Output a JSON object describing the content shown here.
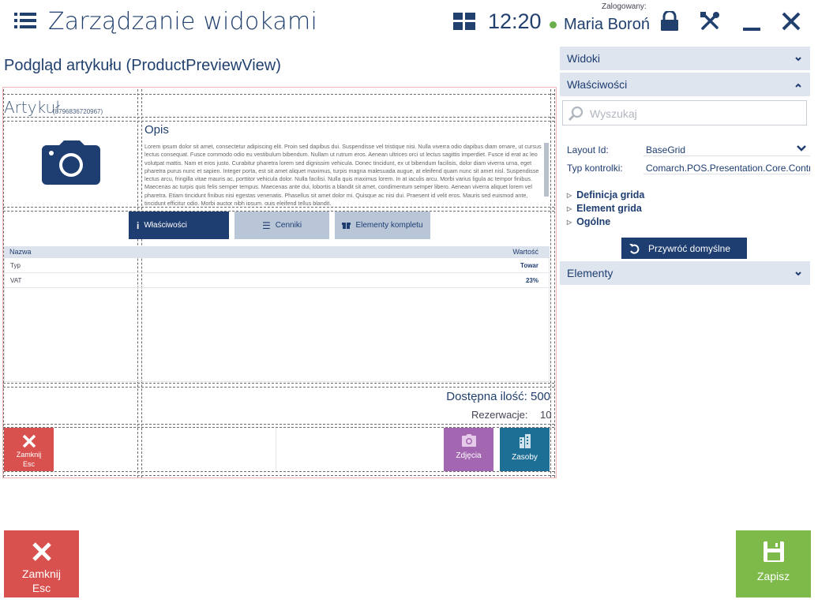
{
  "header": {
    "title": "Zarządzanie widokami",
    "time": "12:20",
    "logged_label": "Zalogowany:",
    "user": "Maria Boroń"
  },
  "preview": {
    "title": "Podgląd artykułu (ProductPreviewView)",
    "article_label": "Artykuł",
    "article_code": "(8796836720967)",
    "description_title": "Opis",
    "description_text": "Lorem ipsum dolor sit amet, consectetur adipiscing elit. Proin sed dapibus dui. Suspendisse vel tristique nisi. Nulla viverra odio dapibus diam ornare, ut cursus lectus consequat. Fusce commodo odio eu vestibulum bibendum. Nullam ut rutrum eros. Aenean ultrices orci ut lectus sagittis imperdiet. Fusce id erat ac leo volutpat mattis. Nam et eros justo. Curabitur pharetra lorem sed dignissim vehicula. Donec tincidunt, ex ut bibendum facilisis, dolor diam viverra urna, eget pharetra purus nunc et sapien. Integer porta, est sit amet aliquet maximus, turpis magna malesuada augue, at eleifend quam nunc sit amet nisl. Suspendisse lectus arcu, fringilla vitae mauris ac, porttitor vehicula dolor. Nulla facilisi. Nulla quis maximus lorem. In at iaculis arcu. Morbi varius ligula ac tempor finibus. Maecenas ac turpis quis felis semper tempus. Maecenas ante dui, lobortis a blandit sit amet, condimentum semper libero. Aenean viverra aliquet lorem vel pharetra. Etiam tincidunt finibus nisi egestas venenatis. Phasellus sit amet dolor mi. Quisque ac nisi dui. Praesent id velit eros. Mauris sed euismod ante, tincidunt efficitur odio. Morbi auctor nibh ipsum, quis eleifend tellus blandit.",
    "tabs": [
      {
        "label": "Właściwości"
      },
      {
        "label": "Cenniki"
      },
      {
        "label": "Elementy kompletu"
      }
    ],
    "table": {
      "col_name": "Nazwa",
      "col_value": "Wartość",
      "rows": [
        {
          "name": "Typ",
          "value": "Towar"
        },
        {
          "name": "VAT",
          "value": "23%"
        }
      ]
    },
    "available": "Dostępna ilość: 500",
    "reservation_label": "Rezerwacje:",
    "reservation_value": "10",
    "buttons": {
      "close_label": "Zamknij",
      "close_key": "Esc",
      "photos_label": "Zdjęcia",
      "assets_label": "Zasoby"
    }
  },
  "panel": {
    "views": "Widoki",
    "properties": "Właściwości",
    "search_placeholder": "Wyszukaj",
    "layout_id_label": "Layout Id:",
    "layout_id_value": "BaseGrid",
    "control_type_label": "Typ kontrolki:",
    "control_type_value": "Comarch.POS.Presentation.Core.Controls",
    "tree": [
      "Definicja grida",
      "Element grida",
      "Ogólne"
    ],
    "restore_label": "Przywróć domyślne",
    "elements": "Elementy"
  },
  "footer": {
    "close_label": "Zamknij",
    "close_key": "Esc",
    "save_label": "Zapisz"
  },
  "colors": {
    "primary": "#1e3d70",
    "danger": "#d9514e",
    "success": "#7dba4a",
    "photos": "#a366b0",
    "assets": "#1e6f95"
  }
}
